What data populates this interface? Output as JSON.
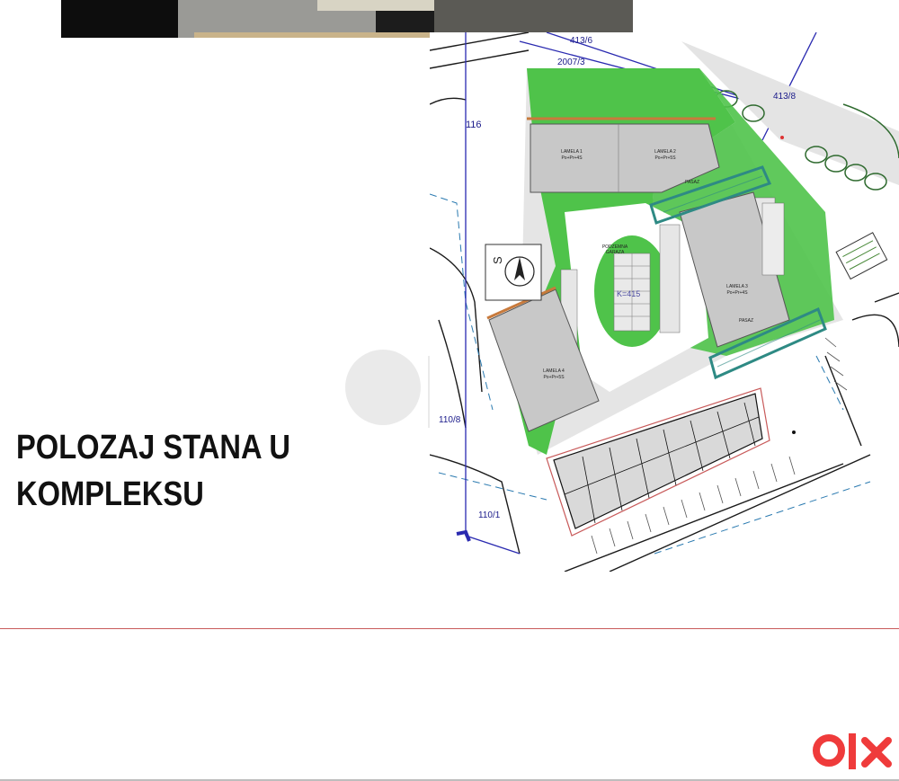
{
  "heading": {
    "line1": "POLOZAJ STANA U",
    "line2": "KOMPLEKSU"
  },
  "plan": {
    "parcels": [
      "413/6",
      "2007/3",
      "413/8",
      "116",
      "110/8",
      "110/1"
    ],
    "building_labels": [
      {
        "name": "LAMELA 1",
        "floors": "Po+Pr+4S"
      },
      {
        "name": "LAMELA 2",
        "floors": "Po+Pr+5S"
      },
      {
        "name": "LAMELA 3",
        "floors": "Po+Pr+4S"
      },
      {
        "name": "LAMELA 4",
        "floors": "Po+Pr+5S"
      }
    ],
    "garage_label": {
      "line1": "PODZEMNA",
      "line2": "GARAZA"
    },
    "passage_label": "PASAZ",
    "elevation_label": "K=415",
    "north_label": "S"
  },
  "colors": {
    "green": "#4fc34a",
    "grey": "#c8c8c8",
    "teal": "#2e8a84",
    "orange": "#c87a3c",
    "blue_line": "#2a2ab0",
    "logo": "#ef3b3b",
    "rule": "#c85a5a"
  },
  "logo": {
    "text": "olx"
  }
}
